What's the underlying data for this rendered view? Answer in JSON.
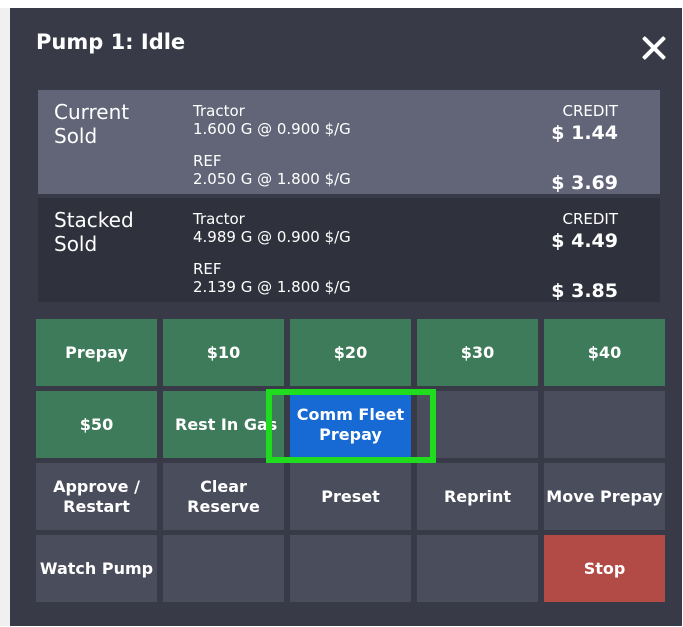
{
  "header": {
    "title": "Pump 1: Idle",
    "close_icon": "close-icon"
  },
  "current_sale": {
    "label_line1": "Current",
    "label_line2": "Sold",
    "item1_name": "Tractor",
    "item1_detail": "1.600 G @ 0.900 $/G",
    "item2_name": "REF",
    "item2_detail": "2.050 G @ 1.800 $/G",
    "tender": "CREDIT",
    "item1_amount": "$ 1.44",
    "item2_amount": "$ 3.69"
  },
  "stacked_sale": {
    "label_line1": "Stacked",
    "label_line2": "Sold",
    "item1_name": "Tractor",
    "item1_detail": "4.989 G @ 0.900 $/G",
    "item2_name": "REF",
    "item2_detail": "2.139 G @ 1.800 $/G",
    "tender": "CREDIT",
    "item1_amount": "$ 4.49",
    "item2_amount": "$ 3.85"
  },
  "buttons": {
    "prepay": "Prepay",
    "p10": "$10",
    "p20": "$20",
    "p30": "$30",
    "p40": "$40",
    "p50": "$50",
    "rest_in_gas": "Rest In Gas",
    "comm_fleet_line1": "Comm Fleet",
    "comm_fleet_line2": "Prepay",
    "approve_line1": "Approve /",
    "approve_line2": "Restart",
    "clear_line1": "Clear",
    "clear_line2": "Reserve",
    "preset": "Preset",
    "reprint": "Reprint",
    "move_prepay": "Move Prepay",
    "watch_pump": "Watch Pump",
    "stop": "Stop"
  },
  "colors": {
    "panel": "#383b47",
    "green": "#3e7b5a",
    "gray": "#4a4d5b",
    "red": "#b24b46",
    "blue": "#1769d4",
    "highlight": "#1fdc1f"
  }
}
